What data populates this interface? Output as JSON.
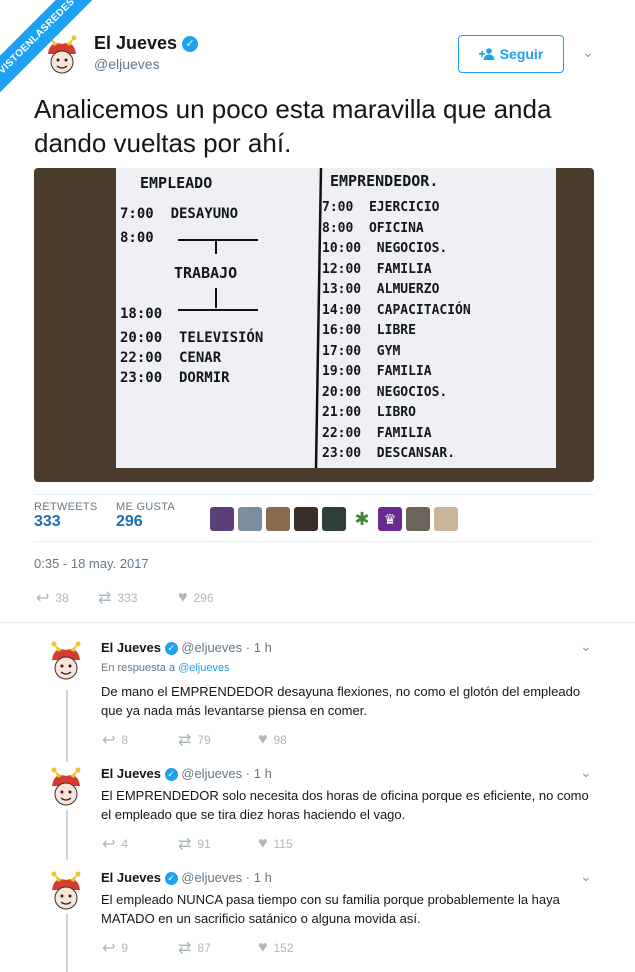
{
  "watermark": "VISTOENLASREDES .com",
  "author": {
    "name": "El Jueves",
    "handle": "@eljueves",
    "avatar_icon": "jester-avatar-icon"
  },
  "follow_button": {
    "label": "Seguir",
    "icon": "add-user-icon"
  },
  "tweet": {
    "text": "Analicemos un poco esta maravilla que anda dando vueltas por ahí.",
    "image": {
      "left_title": "EMPLEADO",
      "left_rows": [
        "7:00  DESAYUNO",
        "8:00",
        "TRABAJO",
        "18:00",
        "20:00  TELEVISIÓN",
        "22:00  CENAR",
        "23:00  DORMIR"
      ],
      "right_title": "EMPRENDEDOR.",
      "right_rows": [
        "7:00  EJERCICIO",
        "8:00  OFICINA",
        "10:00  NEGOCIOS.",
        "12:00  FAMILIA",
        "13:00  ALMUERZO",
        "14:00  CAPACITACIÓN",
        "16:00  LIBRE",
        "17:00  GYM",
        "19:00  FAMILIA",
        "20:00  NEGOCIOS.",
        "21:00  LIBRO",
        "22:00  FAMILIA",
        "23:00  DESCANSAR."
      ]
    },
    "stats": {
      "retweets_label": "RETWEETS",
      "retweets": "333",
      "likes_label": "ME GUSTA",
      "likes": "296"
    },
    "timestamp": "0:35 - 18 may. 2017",
    "actions": {
      "replies": "38",
      "retweets": "333",
      "likes": "296"
    }
  },
  "colors": {
    "accent": "#1da1f2",
    "stat_value": "#1b6fb4",
    "muted": "#657786",
    "action": "#aab8c2"
  },
  "replies": [
    {
      "name": "El Jueves",
      "handle": "@eljueves",
      "time": "· 1 h",
      "in_reply_prefix": "En respuesta a",
      "in_reply_handle": "@eljueves",
      "text": "De mano el EMPRENDEDOR desayuna flexiones, no como el glotón del empleado que ya nada más levantarse piensa en comer.",
      "replies": "8",
      "retweets": "79",
      "likes": "98"
    },
    {
      "name": "El Jueves",
      "handle": "@eljueves",
      "time": "· 1 h",
      "text": "El EMPRENDEDOR solo necesita dos horas de oficina porque es eficiente, no como el empleado que se tira diez horas haciendo el vago.",
      "replies": "4",
      "retweets": "91",
      "likes": "115"
    },
    {
      "name": "El Jueves",
      "handle": "@eljueves",
      "time": "· 1 h",
      "text": "El empleado NUNCA pasa tiempo con su familia porque probablemente la haya MATADO en un sacrificio satánico o alguna movida así.",
      "replies": "9",
      "retweets": "87",
      "likes": "152"
    }
  ]
}
